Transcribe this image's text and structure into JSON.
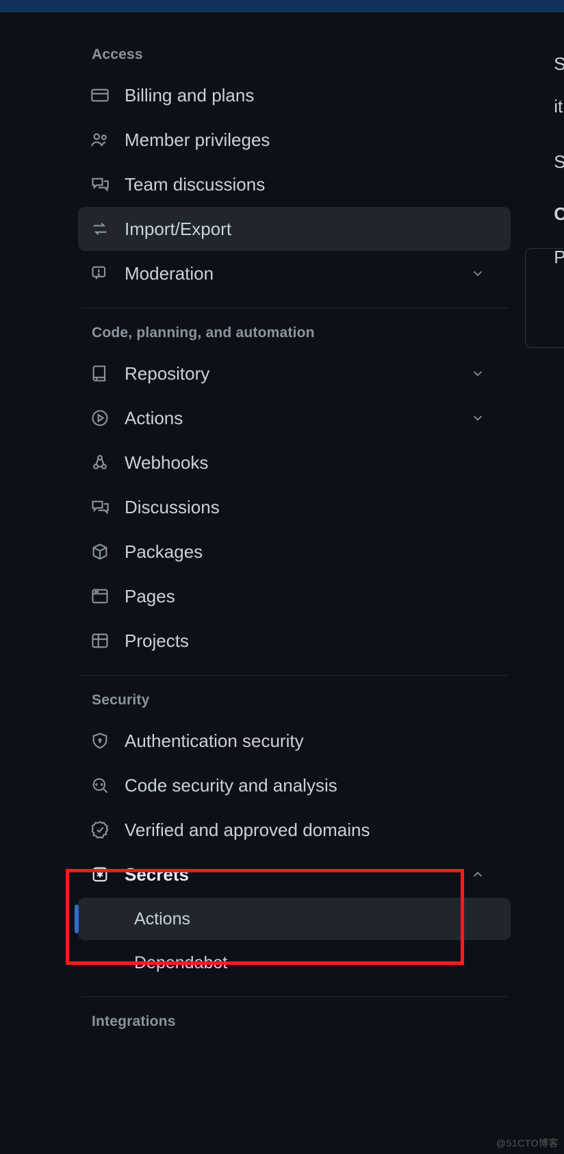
{
  "sections": {
    "access": {
      "header": "Access",
      "items": {
        "billing": "Billing and plans",
        "member_privileges": "Member privileges",
        "team_discussions": "Team discussions",
        "import_export": "Import/Export",
        "moderation": "Moderation"
      }
    },
    "code": {
      "header": "Code, planning, and automation",
      "items": {
        "repository": "Repository",
        "actions": "Actions",
        "webhooks": "Webhooks",
        "discussions": "Discussions",
        "packages": "Packages",
        "pages": "Pages",
        "projects": "Projects"
      }
    },
    "security": {
      "header": "Security",
      "items": {
        "auth_security": "Authentication security",
        "code_security": "Code security and analysis",
        "verified_domains": "Verified and approved domains",
        "secrets": "Secrets"
      },
      "secrets_children": {
        "actions": "Actions",
        "dependabot": "Dependabot"
      }
    },
    "integrations": {
      "header": "Integrations"
    }
  },
  "right_fragments": {
    "l1": "S",
    "l2": "it",
    "l3": "S",
    "l4": "C",
    "l5": "P"
  },
  "watermark": "@51CTO博客"
}
